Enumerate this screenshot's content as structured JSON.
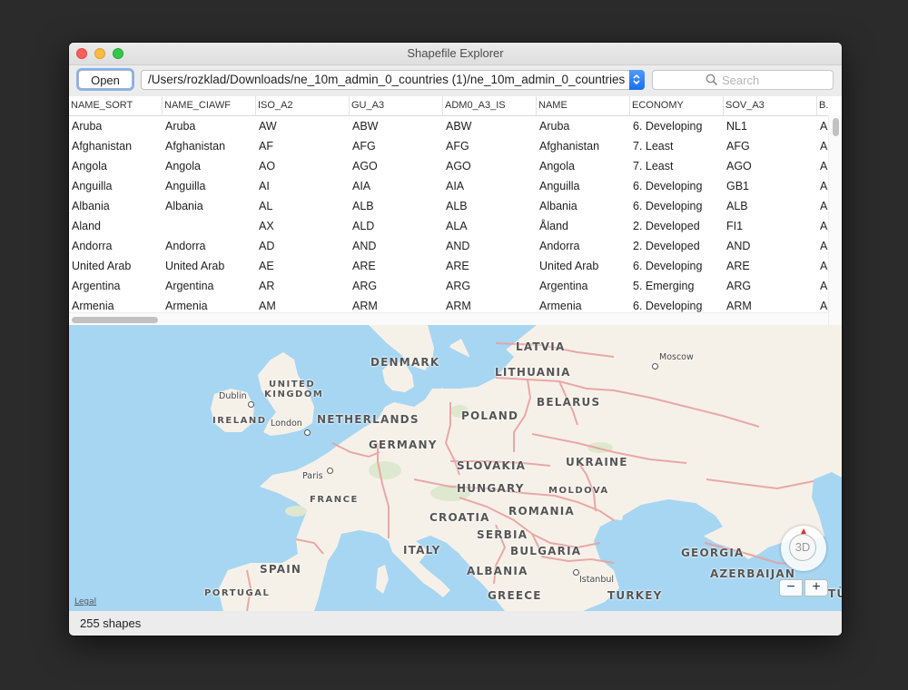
{
  "window": {
    "title": "Shapefile Explorer"
  },
  "toolbar": {
    "open_label": "Open",
    "path_value": "/Users/rozklad/Downloads/ne_10m_admin_0_countries (1)/ne_10m_admin_0_countries",
    "search_placeholder": "Search"
  },
  "table": {
    "columns": [
      "NAME_SORT",
      "NAME_CIAWF",
      "ISO_A2",
      "GU_A3",
      "ADM0_A3_IS",
      "NAME",
      "ECONOMY",
      "SOV_A3",
      "B."
    ],
    "rows": [
      [
        "Aruba",
        "Aruba",
        "AW",
        "ABW",
        "ABW",
        "Aruba",
        "6. Developing",
        "NL1",
        "A"
      ],
      [
        "Afghanistan",
        "Afghanistan",
        "AF",
        "AFG",
        "AFG",
        "Afghanistan",
        "7. Least",
        "AFG",
        "A"
      ],
      [
        "Angola",
        "Angola",
        "AO",
        "AGO",
        "AGO",
        "Angola",
        "7. Least",
        "AGO",
        "A"
      ],
      [
        "Anguilla",
        "Anguilla",
        "AI",
        "AIA",
        "AIA",
        "Anguilla",
        "6. Developing",
        "GB1",
        "A"
      ],
      [
        "Albania",
        "Albania",
        "AL",
        "ALB",
        "ALB",
        "Albania",
        "6. Developing",
        "ALB",
        "A"
      ],
      [
        "Aland",
        "",
        "AX",
        "ALD",
        "ALA",
        "Åland",
        "2. Developed",
        "FI1",
        "A"
      ],
      [
        "Andorra",
        "Andorra",
        "AD",
        "AND",
        "AND",
        "Andorra",
        "2. Developed",
        "AND",
        "A"
      ],
      [
        "United Arab",
        "United Arab",
        "AE",
        "ARE",
        "ARE",
        "United Arab",
        "6. Developing",
        "ARE",
        "A"
      ],
      [
        "Argentina",
        "Argentina",
        "AR",
        "ARG",
        "ARG",
        "Argentina",
        "5. Emerging",
        "ARG",
        "A"
      ],
      [
        "Armenia",
        "Armenia",
        "AM",
        "ARM",
        "ARM",
        "Armenia",
        "6. Developing",
        "ARM",
        "A"
      ]
    ]
  },
  "map": {
    "countries": {
      "latvia": "LATVIA",
      "denmark": "DENMARK",
      "lithuania": "LITHUANIA",
      "united_kingdom_1": "UNITED",
      "united_kingdom_2": "KINGDOM",
      "belarus": "BELARUS",
      "ireland": "IRELAND",
      "netherlands": "NETHERLANDS",
      "poland": "POLAND",
      "germany": "GERMANY",
      "ukraine": "UKRAINE",
      "slovakia": "SLOVAKIA",
      "france": "FRANCE",
      "hungary": "HUNGARY",
      "moldova": "MOLDOVA",
      "romania": "ROMANIA",
      "croatia": "CROATIA",
      "serbia": "SERBIA",
      "italy": "ITALY",
      "bulgaria": "BULGARIA",
      "georgia": "GEORGIA",
      "spain": "SPAIN",
      "albania": "ALBANIA",
      "azerbaijan": "AZERBAIJAN",
      "portugal": "PORTUGAL",
      "greece": "GREECE",
      "turkey": "TURKEY",
      "turkmen_partial": "TÜRKM"
    },
    "cities": {
      "moscow": "Moscow",
      "dublin": "Dublin",
      "london": "London",
      "paris": "Paris",
      "istanbul": "Istanbul"
    },
    "legal_label": "Legal",
    "compass_label": "3D",
    "zoom_out_label": "−",
    "zoom_in_label": "+",
    "colors": {
      "water": "#a6d6f2",
      "land": "#f6f1e8",
      "border": "#e8a0a0",
      "park": "#dde8cf"
    }
  },
  "status": {
    "shape_count": "255 shapes"
  }
}
